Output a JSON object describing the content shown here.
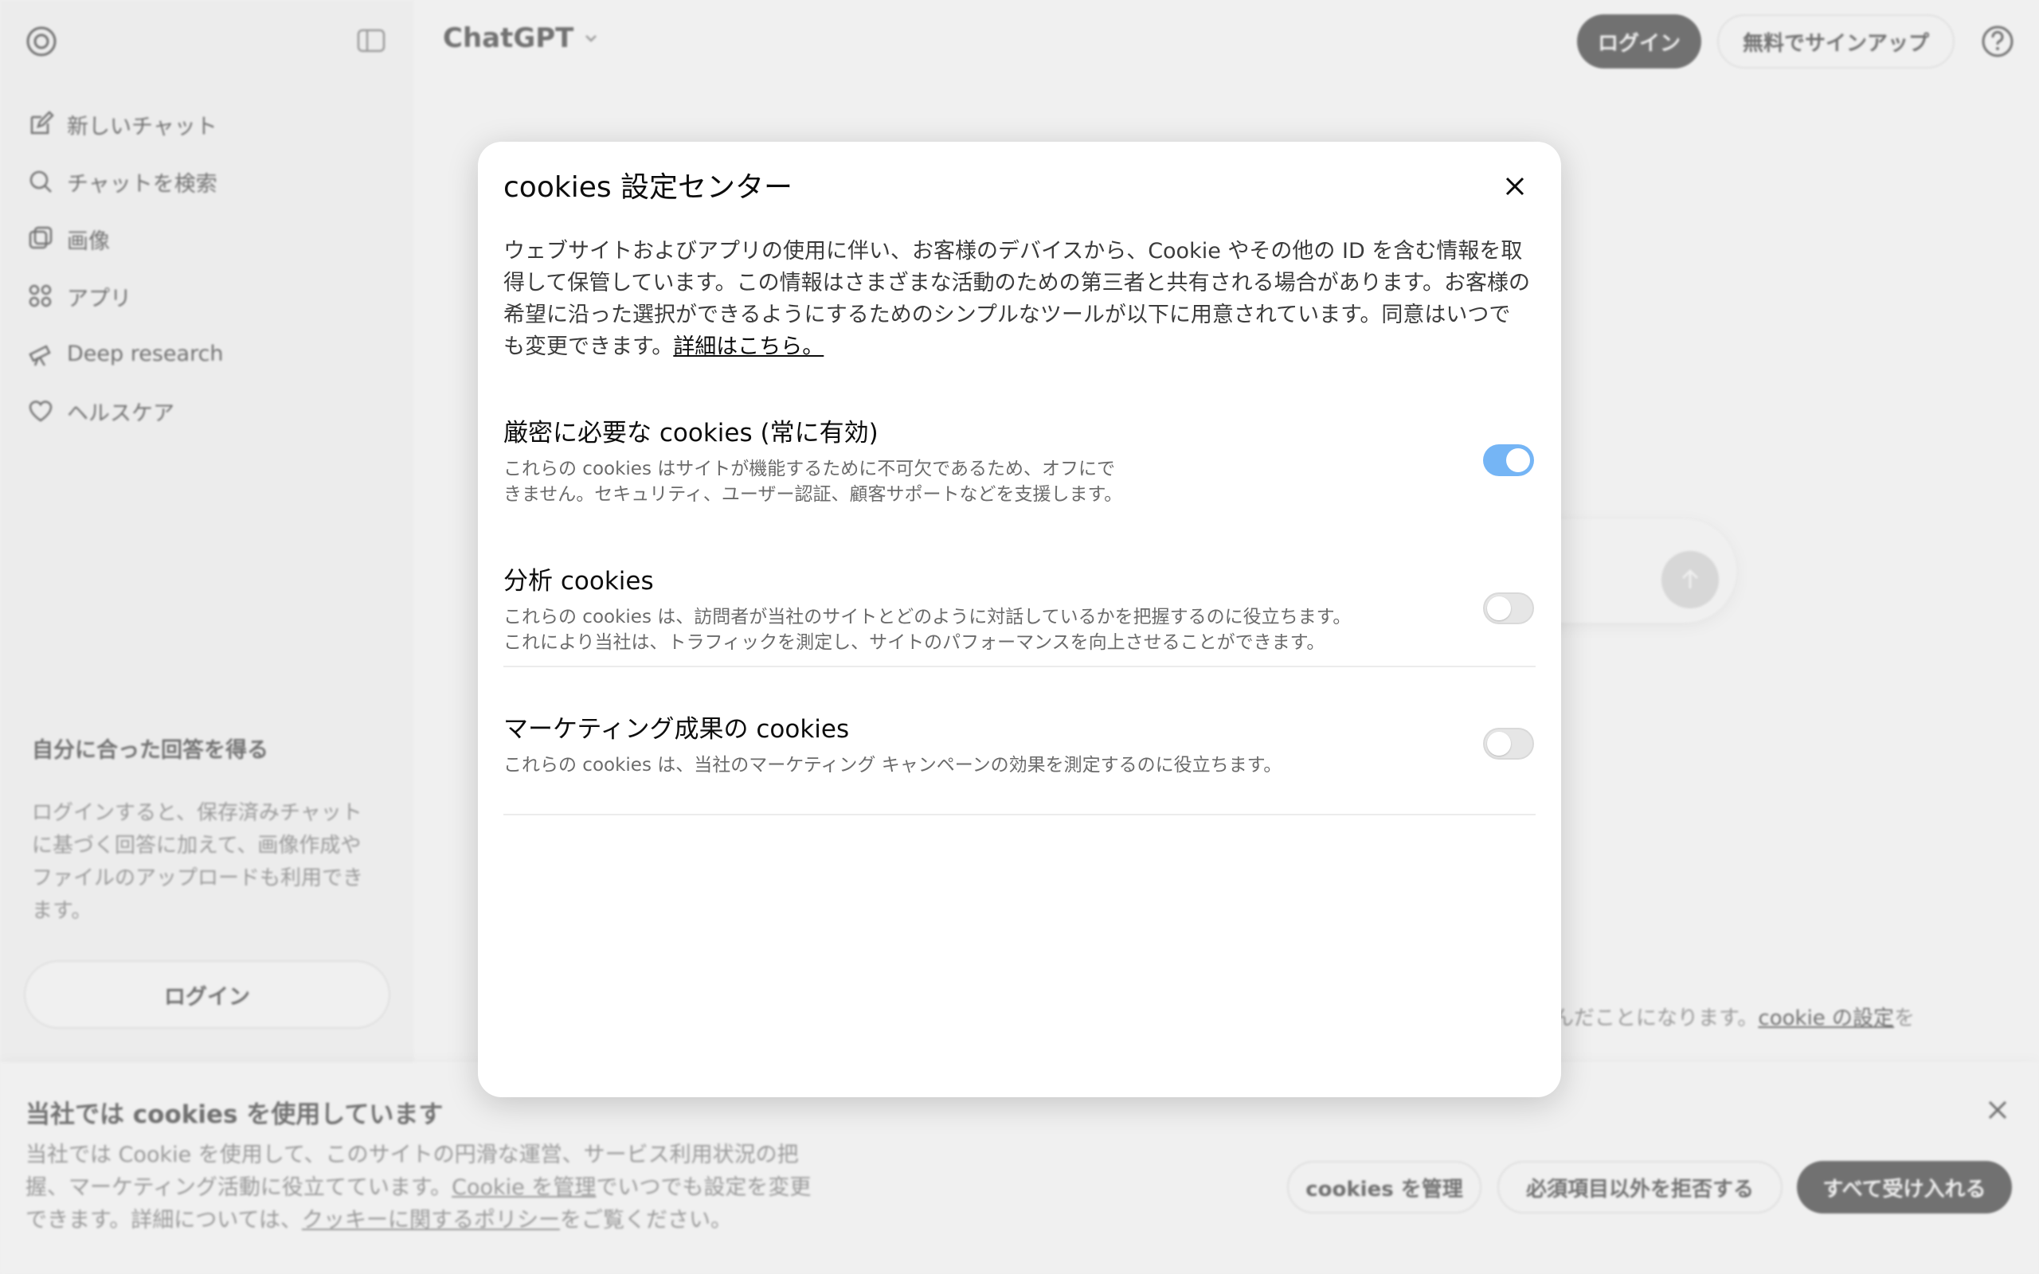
{
  "sidebar": {
    "items": [
      {
        "label": "新しいチャット",
        "icon": "edit-icon"
      },
      {
        "label": "チャットを検索",
        "icon": "search-icon"
      },
      {
        "label": "画像",
        "icon": "image-icon"
      },
      {
        "label": "アプリ",
        "icon": "apps-icon"
      },
      {
        "label": "Deep research",
        "icon": "telescope-icon"
      },
      {
        "label": "ヘルスケア",
        "icon": "heart-icon"
      }
    ],
    "promo_title": "自分に合った回答を得る",
    "promo_text": "ログインすると、保存済みチャットに基づく回答に加えて、画像作成やファイルのアップロードも利用できます。",
    "login_label": "ログイン"
  },
  "header": {
    "brand": "ChatGPT",
    "login_label": "ログイン",
    "signup_label": "無料でサインアップ"
  },
  "terms": {
    "text": "んだことになります。",
    "link": "cookie の設定",
    "suffix": "を"
  },
  "cookie_bar": {
    "title": "当社では cookies を使用しています",
    "text_1": "当社では Cookie を使用して、このサイトの円滑な運営、サービス利用状況の把握、マーケティング活動に役立てています。",
    "link_1": "Cookie を管理",
    "text_2": "でいつでも設定を変更できます。詳細については、",
    "link_2": "クッキーに関するポリシー",
    "text_3": "をご覧ください。",
    "manage_label": "cookies を管理",
    "reject_label": "必須項目以外を拒否する",
    "accept_label": "すべて受け入れる"
  },
  "modal": {
    "title": "cookies 設定センター",
    "description": "ウェブサイトおよびアプリの使用に伴い、お客様のデバイスから、Cookie やその他の ID を含む情報を取得して保管しています。この情報はさまざまな活動のための第三者と共有される場合があります。お客様の希望に沿った選択ができるようにするためのシンプルなツールが以下に用意されています。同意はいつでも変更できます。",
    "learn_more": "詳細はこちら。",
    "sections": [
      {
        "title": "厳密に必要な cookies (常に有効)",
        "desc_1": "これらの cookies はサイトが機能するために不可欠であるため、オフにで",
        "desc_2": "きません。セキュリティ、ユーザー認証、顧客サポートなどを支援します。",
        "enabled": true
      },
      {
        "title": "分析 cookies",
        "desc_1": "これらの cookies は、訪問者が当社のサイトとどのように対話しているかを把握するのに役立ちます。",
        "desc_2": "これにより当社は、トラフィックを測定し、サイトのパフォーマンスを向上させることができます。",
        "enabled": false
      },
      {
        "title": "マーケティング成果の cookies",
        "desc_1": "これらの cookies は、当社のマーケティング キャンペーンの効果を測定するのに役立ちます。",
        "enabled": false
      }
    ]
  },
  "colors": {
    "toggle_on": "#75b5f5",
    "toggle_off": "#e6e6e6",
    "primary_button": "#0d0d0d"
  }
}
